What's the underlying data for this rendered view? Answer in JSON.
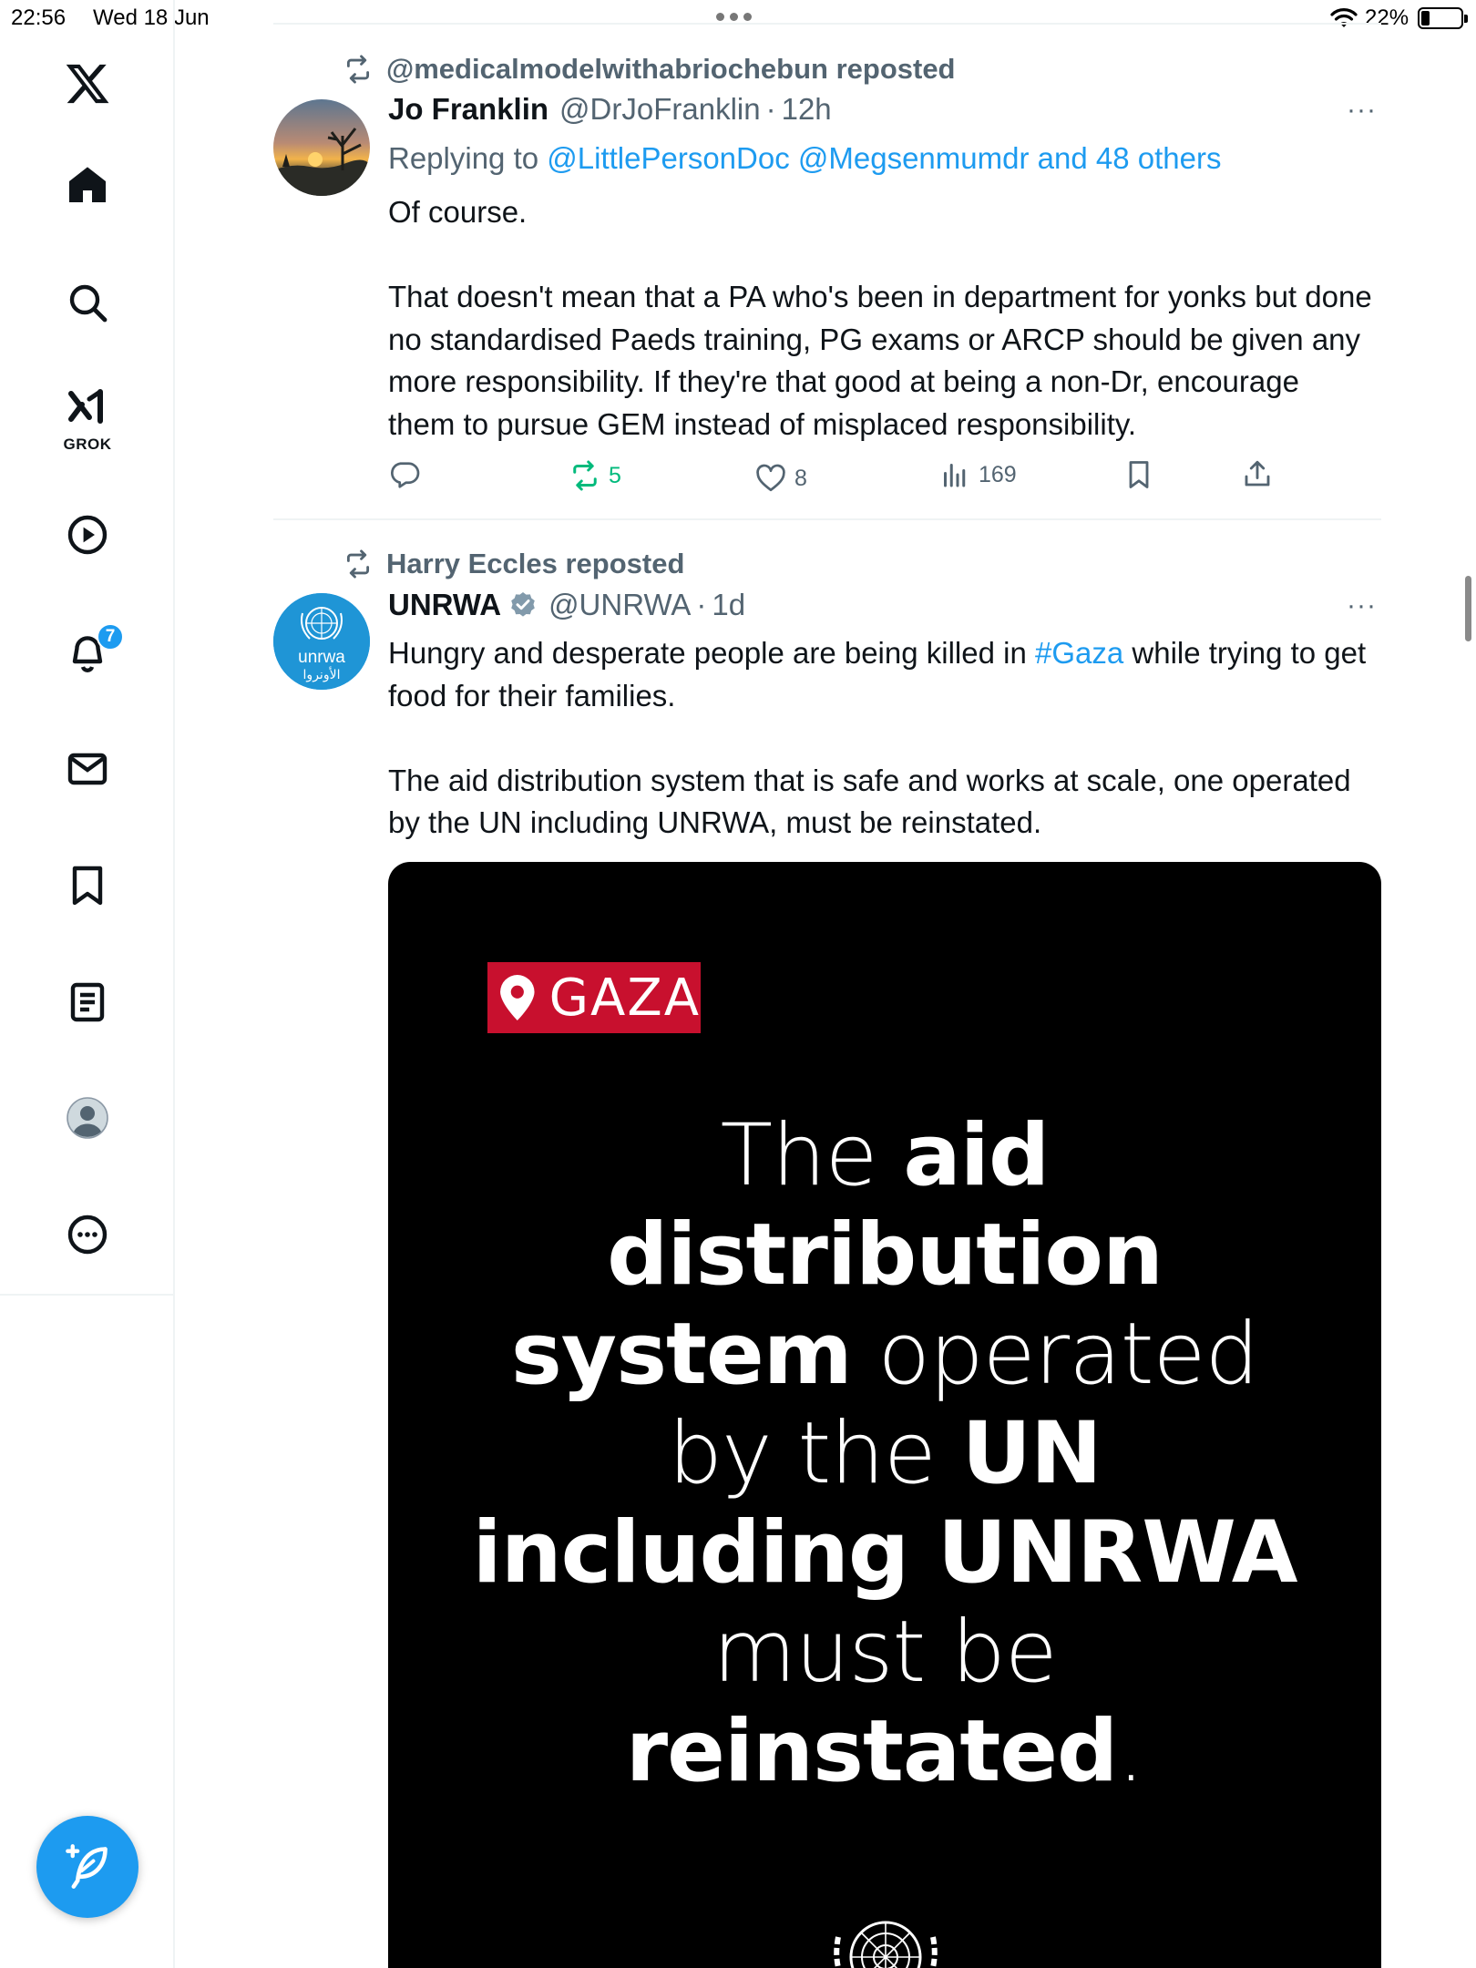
{
  "status_bar": {
    "time": "22:56",
    "date": "Wed 18 Jun",
    "battery": "22%"
  },
  "sidebar": {
    "logo": "x-logo-icon",
    "items": [
      {
        "name": "home",
        "icon": "home-icon"
      },
      {
        "name": "explore",
        "icon": "search-icon"
      },
      {
        "name": "grok",
        "icon": "grok-icon",
        "label": "GROK"
      },
      {
        "name": "videos",
        "icon": "play-icon"
      },
      {
        "name": "notifications",
        "icon": "bell-icon",
        "badge": "7"
      },
      {
        "name": "messages",
        "icon": "mail-icon"
      },
      {
        "name": "bookmarks",
        "icon": "bookmark-icon"
      },
      {
        "name": "lists",
        "icon": "list-icon"
      },
      {
        "name": "profile",
        "icon": "avatar-icon"
      },
      {
        "name": "more",
        "icon": "more-circle-icon"
      }
    ],
    "compose_icon": "compose-icon"
  },
  "timeline": {
    "tweets": [
      {
        "repost_by": "@medicalmodelwithabriochebun reposted",
        "name": "Jo Franklin",
        "handle": "@DrJoFranklin",
        "dot": "·",
        "time": "12h",
        "more": "···",
        "reply_prefix": "Replying to ",
        "reply_to": "@LittlePersonDoc @Megsenmumdr and 48 others",
        "text_1": "Of course.",
        "text_2": "That doesn't mean that a PA who's been in department for yonks but done no standardised Paeds training, PG exams or ARCP should be given any more responsibility. If they're that good at being a non-Dr, encourage them to pursue GEM instead of misplaced responsibility.",
        "actions": {
          "replies": "",
          "reposts": "5",
          "likes": "8",
          "views": "169"
        }
      },
      {
        "repost_by": "Harry Eccles reposted",
        "name": "UNRWA",
        "handle": "@UNRWA",
        "dot": "·",
        "time": "1d",
        "more": "···",
        "text_1a": "Hungry and desperate people are being killed in ",
        "hashtag": "#Gaza",
        "text_1b": " while trying to get food for their families.",
        "text_2": "The aid distribution system that is safe and works at scale, one operated by the UN including UNRWA, must be reinstated.",
        "avatar_logo_text": "unrwa",
        "avatar_logo_arabic": "الأونروا",
        "media": {
          "tag": "GAZA",
          "line1_light": "The ",
          "line1_bold": "aid",
          "line2_bold": "distribution",
          "line3_bold": "system",
          "line3_light": " operated",
          "line4_light": "by the ",
          "line4_bold": "UN",
          "line5_bold": "including UNRWA",
          "line6_light": "must be",
          "line7_bold": "reinstated",
          "line7_light": "."
        }
      }
    ]
  },
  "colors": {
    "accent": "#1d9bf0",
    "repost_green": "#00ba7c",
    "gaza_red": "#c8102e",
    "muted": "#536471"
  }
}
